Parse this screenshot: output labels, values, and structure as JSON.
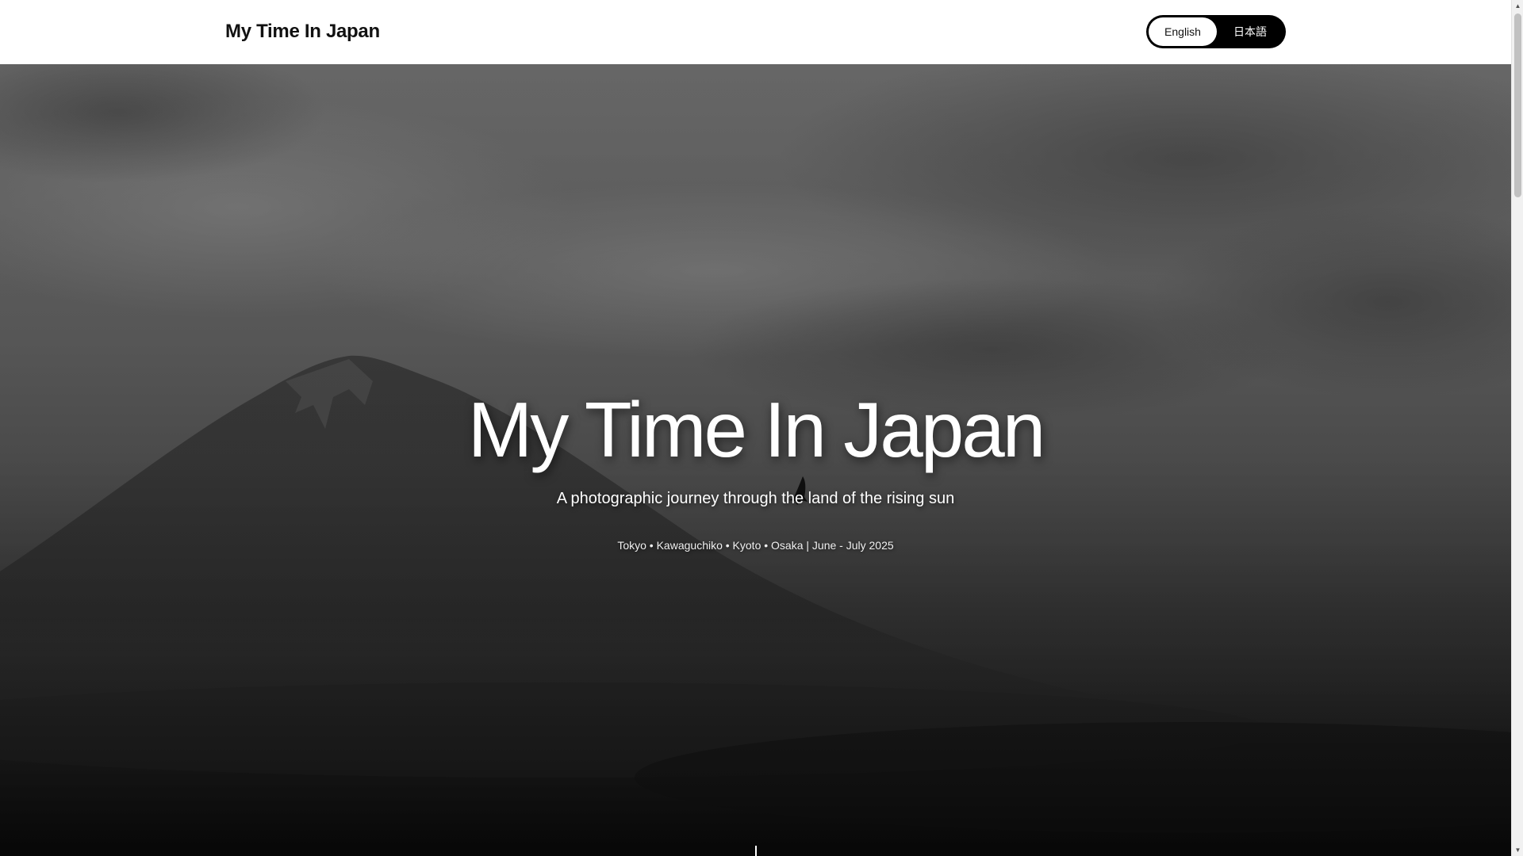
{
  "header": {
    "brand": "My Time In Japan",
    "languages": [
      {
        "label": "English",
        "active": true
      },
      {
        "label": "日本語",
        "active": false
      }
    ]
  },
  "hero": {
    "title": "My Time In Japan",
    "subtitle": "A photographic journey through the land of the rising sun",
    "meta": "Tokyo • Kawaguchiko • Kyoto • Osaka | June - July 2025",
    "background_image": "grayscale photo of Mount Fuji with clouds and a bird in flight"
  },
  "scrollbar": {
    "up_icon": "arrow-up-icon",
    "down_icon": "arrow-down-icon"
  }
}
